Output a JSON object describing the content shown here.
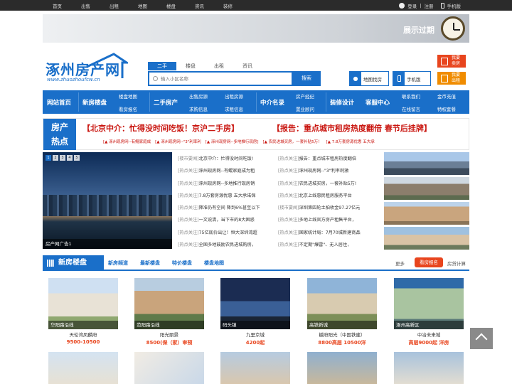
{
  "topbar": {
    "nav": [
      "首页",
      "出售",
      "出租",
      "地图",
      "楼盘",
      "资讯",
      "装修"
    ],
    "login": "登录",
    "sep": "|",
    "register": "注册",
    "mobile": "手机版"
  },
  "banner": {
    "text": "展示过期"
  },
  "logo": {
    "name": "涿州房产网",
    "url": "www.zhuozhoufcw.cn"
  },
  "search": {
    "tabs": [
      "二手",
      "楼盘",
      "出租",
      "资讯"
    ],
    "placeholder": "输入小区名称",
    "button": "搜索",
    "map_btn": "地图找房",
    "mobile_btn": "手机版",
    "sell_l1": "我要",
    "sell_l2": "卖房",
    "rent_l1": "我要",
    "rent_l2": "出租"
  },
  "mainnav": {
    "home": "网站首页",
    "newhouse": "新房楼盘",
    "map": "楼盘地图",
    "report": "看房报名",
    "second": "二手房产",
    "sale": "出售房源",
    "wanted": "求购信息",
    "rentsrc": "出租房源",
    "rentwant": "求租信息",
    "agent": "中介名录",
    "broker": "房产经纪",
    "dir": "置业顾问",
    "decor": "装修设计",
    "service": "客服中心",
    "contact": "联系我们",
    "msg": "在线留言",
    "gold": "金币充值",
    "priv": "特权套餐"
  },
  "hot": {
    "label1": "房产",
    "label2": "热点",
    "h1": "【北京中介：忙得没时间吃饭！京沪二手房】",
    "h2": "【报告：重点城市租房热度翻倍 春节后挂牌】",
    "subs": [
      "[▲ 涿州现房网--有鲲家庭成",
      "[▲ 涿州现房网--\"3\"利率利",
      "[▲ 涿州现房网--多地推行现房]",
      "[▲ 农民进城买房，一套补贴5万！",
      "[▲ 7.8万套房源优惠 五大承"
    ]
  },
  "slider": {
    "dots": [
      "1",
      "2",
      "3",
      "4",
      "5"
    ],
    "caption": "房产网广告1"
  },
  "news_left": [
    {
      "tag": "[楼市要闻]",
      "text": "北京中介：忙得没时间吃饭!"
    },
    {
      "tag": "[热点关注]",
      "text": "涿州现房网--有鲲家庭成为租"
    },
    {
      "tag": "[热点关注]",
      "text": "涿州现房网--多地推行现房销"
    },
    {
      "tag": "[热点关注]",
      "text": "7.8万套房源优惠 五大承诺保"
    },
    {
      "tag": "[热点关注]",
      "text": "降准仍有空间 降到6%甚至以下"
    },
    {
      "tag": "[热点关注]",
      "text": "一文说清，当下市的8大困惑"
    },
    {
      "tag": "[热点关注]",
      "text": "75亿底价出让！恒大深圳湾超"
    },
    {
      "tag": "[热点关注]",
      "text": "全国多地鼓励农民进城购房，"
    }
  ],
  "news_right": [
    {
      "tag": "[热点关注]",
      "text": "报告：重点城市租房热度翻倍"
    },
    {
      "tag": "[热点关注]",
      "text": "涿州现房网--\"3\"利率刺激"
    },
    {
      "tag": "[热点关注]",
      "text": "农民进城买房，一套补贴5万!"
    },
    {
      "tag": "[热点关注]",
      "text": "北京上线惠民租房服务平台"
    },
    {
      "tag": "[楼市要闻]",
      "text": "深圳第四轮土拍收金97.27亿元"
    },
    {
      "tag": "[热点关注]",
      "text": "多地上线官方房产租售平台，"
    },
    {
      "tag": "[热点关注]",
      "text": "国家统计局：7月70城新建商品"
    },
    {
      "tag": "[热点关注]",
      "text": "不定期\"爆雷\"、无人居住，"
    }
  ],
  "section": {
    "title": "新房楼盘",
    "links": [
      "新房频道",
      "最新楼盘",
      "特价楼盘",
      "楼盘地图"
    ],
    "more": "更多",
    "kan": "看房报名",
    "calc": "房贷计算"
  },
  "properties": [
    {
      "tag": "华阳路沿线",
      "name": "天伦湾凤麟府",
      "price": "9500-10500"
    },
    {
      "tag": "范阳路沿线",
      "name": "阳光丽景",
      "price": "8500(保（家）审预"
    },
    {
      "tag": "码头镇",
      "name": "九里京城",
      "price": "4200起"
    },
    {
      "tag": "高铁新城",
      "name": "樾府阳光（中国铁建）",
      "price": "8800高层 10500洋"
    },
    {
      "tag": "涿州高新区",
      "name": "中冶未来城",
      "price": "高层9000起 洋房"
    }
  ]
}
